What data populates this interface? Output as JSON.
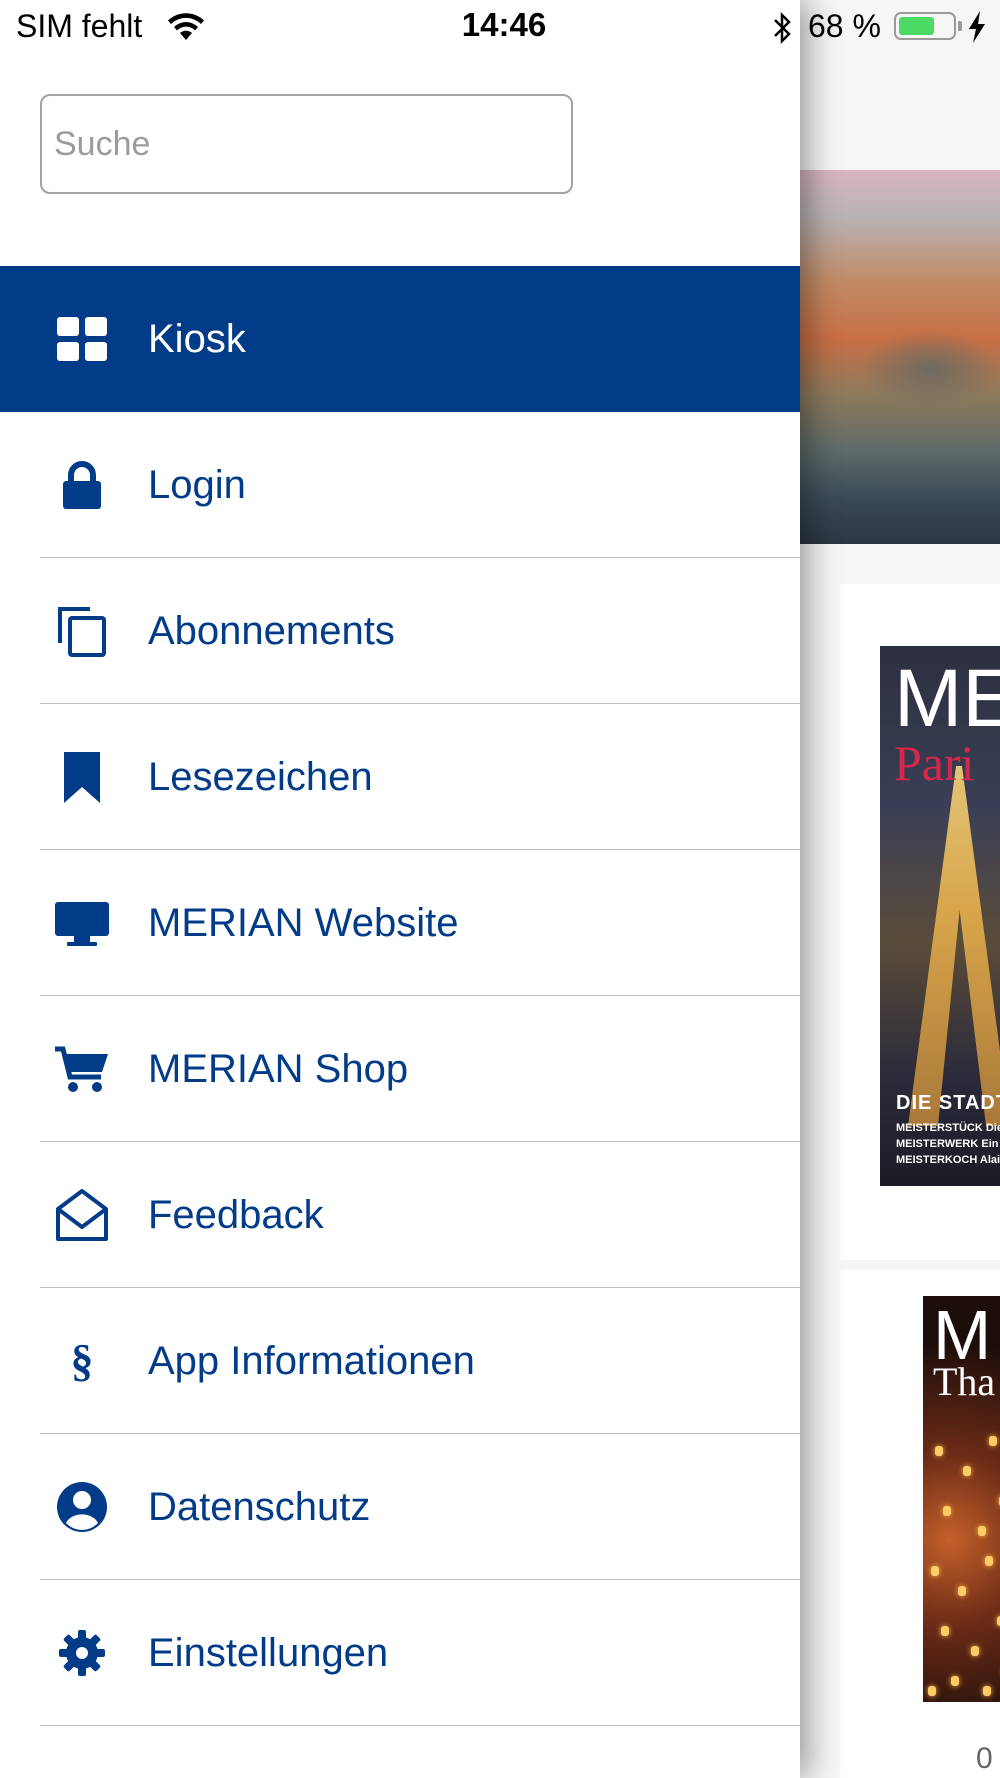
{
  "status_bar": {
    "carrier": "SIM fehlt",
    "time": "14:46",
    "battery_percent": "68 %",
    "battery_level": 0.68,
    "icons": [
      "wifi-icon",
      "bluetooth-icon",
      "battery-icon",
      "charging-icon"
    ]
  },
  "drawer": {
    "search": {
      "placeholder": "Suche",
      "value": ""
    },
    "menu": [
      {
        "label": "Kiosk",
        "icon": "grid-icon",
        "active": true
      },
      {
        "label": "Login",
        "icon": "lock-icon"
      },
      {
        "label": "Abonnements",
        "icon": "copy-icon"
      },
      {
        "label": "Lesezeichen",
        "icon": "bookmark-icon"
      },
      {
        "label": "MERIAN Website",
        "icon": "monitor-icon"
      },
      {
        "label": "MERIAN Shop",
        "icon": "cart-icon"
      },
      {
        "label": "Feedback",
        "icon": "open-envelope-icon"
      },
      {
        "label": "App Informationen",
        "icon": "section-sign-icon"
      },
      {
        "label": "Datenschutz",
        "icon": "user-circle-icon"
      },
      {
        "label": "Einstellungen",
        "icon": "gear-icon"
      }
    ]
  },
  "background": {
    "cover1": {
      "title": "ME",
      "subtitle": "Pari",
      "label": "DIE STADT",
      "lines": [
        "MEISTERSTÜCK Die",
        "MEISTERWERK Ein",
        "MEISTERKOCH Alain"
      ]
    },
    "cover2": {
      "title": "M",
      "subtitle": "Tha"
    },
    "bottom_text": "0"
  },
  "colors": {
    "accent": "#023b87",
    "active_label": "#ffffff",
    "divider": "#bdbdbd",
    "battery_fill": "#4cd964"
  }
}
